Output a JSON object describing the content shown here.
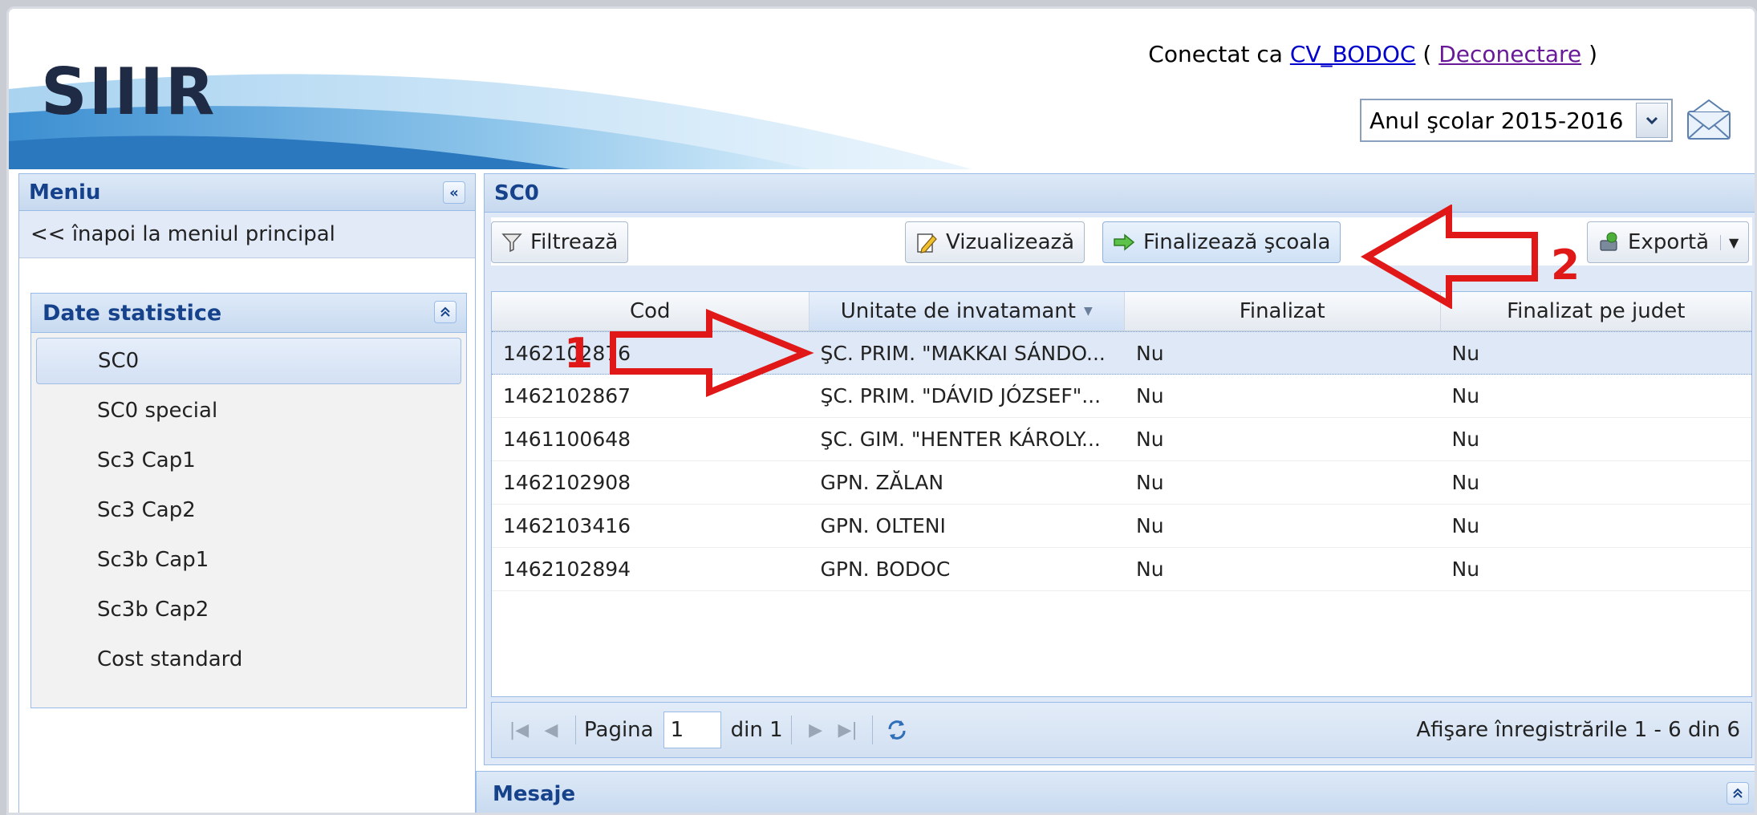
{
  "header": {
    "logo": "SIIIR",
    "connected_prefix": "Conectat ca",
    "user": "CV_BODOC",
    "open_paren": "(",
    "logout": "Deconectare",
    "close_paren": ")",
    "school_year": "Anul şcolar 2015-2016"
  },
  "sidebar": {
    "title": "Meniu",
    "back_link": "<< înapoi la meniul principal",
    "section_title": "Date statistice",
    "items": [
      {
        "label": "SC0"
      },
      {
        "label": "SC0 special"
      },
      {
        "label": "Sc3 Cap1"
      },
      {
        "label": "Sc3 Cap2"
      },
      {
        "label": "Sc3b Cap1"
      },
      {
        "label": "Sc3b Cap2"
      },
      {
        "label": "Cost standard"
      }
    ]
  },
  "main": {
    "title": "SC0",
    "toolbar": {
      "filter": "Filtrează",
      "view": "Vizualizează",
      "finalize": "Finalizează şcoala",
      "export": "Exportă"
    },
    "columns": [
      "Cod",
      "Unitate de invatamant",
      "Finalizat",
      "Finalizat pe judet"
    ],
    "rows": [
      [
        "1462102876",
        "ŞC. PRIM. \"MAKKAI SÁNDO...",
        "Nu",
        "Nu"
      ],
      [
        "1462102867",
        "ŞC. PRIM. \"DÁVID JÓZSEF\"...",
        "Nu",
        "Nu"
      ],
      [
        "1461100648",
        "ŞC. GIM. \"HENTER KÁROLY...",
        "Nu",
        "Nu"
      ],
      [
        "1462102908",
        "GPN. ZĂLAN",
        "Nu",
        "Nu"
      ],
      [
        "1462103416",
        "GPN. OLTENI",
        "Nu",
        "Nu"
      ],
      [
        "1462102894",
        "GPN. BODOC",
        "Nu",
        "Nu"
      ]
    ],
    "pager": {
      "page_label": "Pagina",
      "page_value": "1",
      "of_label": "din 1",
      "info": "Afişare înregistrările 1 - 6 din 6"
    }
  },
  "messages": {
    "title": "Mesaje"
  },
  "annotations": {
    "marker_1": "1",
    "marker_2": "2",
    "color": "#e01818"
  }
}
